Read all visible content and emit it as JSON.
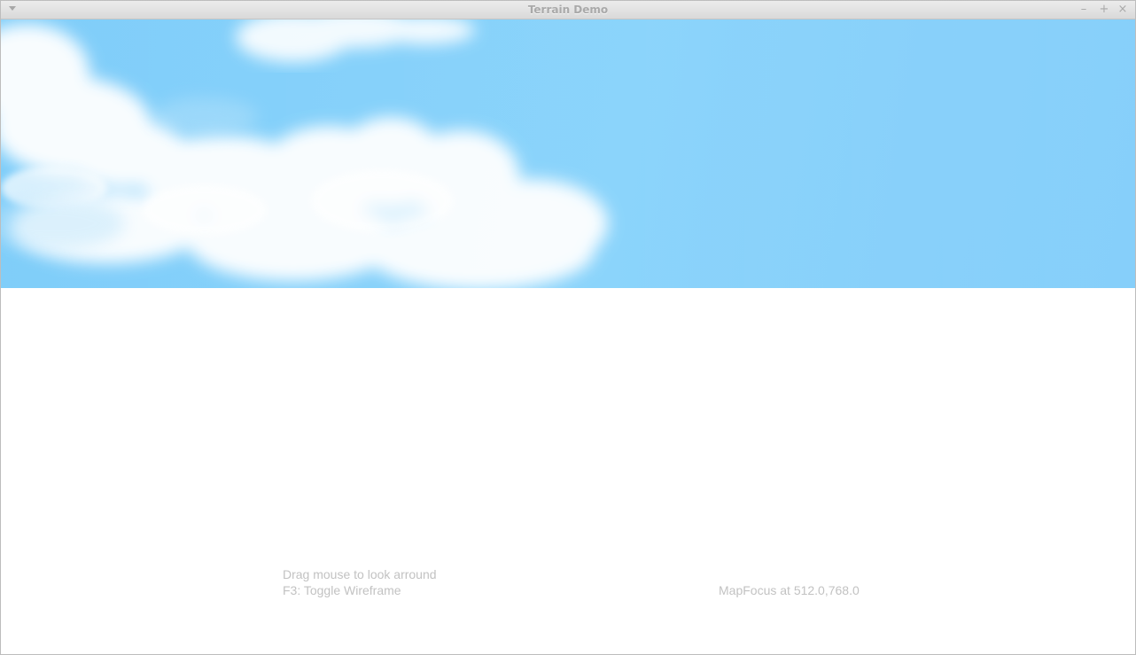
{
  "window": {
    "title": "Terrain Demo",
    "controls": {
      "menu_icon": "chevron-down-icon",
      "minimize_icon": "minimize-icon",
      "maximize_icon": "maximize-icon",
      "close_icon": "close-icon"
    }
  },
  "viewport": {
    "sky_color": "#80cdfa",
    "cloud_color": "#ffffff",
    "ground_color": "#ffffff"
  },
  "hud": {
    "hint_look": "Drag mouse to look arround",
    "hint_wireframe": "F3: Toggle Wireframe",
    "map_focus": "MapFocus at 512.0,768.0"
  }
}
